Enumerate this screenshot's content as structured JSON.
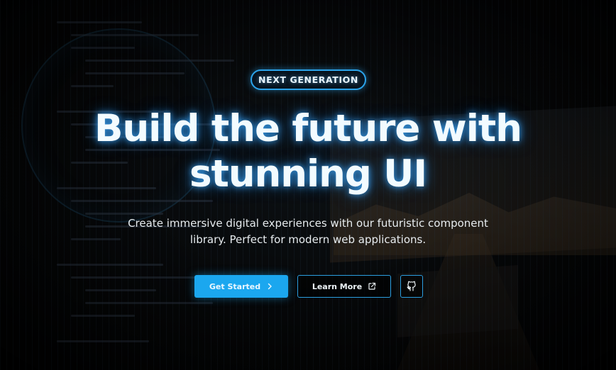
{
  "hero": {
    "badge": "NEXT GENERATION",
    "title": "Build the future with stunning UI",
    "subtitle": "Create immersive digital experiences with our futuristic component library. Perfect for modern web applications."
  },
  "actions": {
    "primary_label": "Get Started",
    "primary_icon": "chevron-right-icon",
    "secondary_label": "Learn More",
    "secondary_icon": "external-link-icon",
    "icon_button_icon": "github-icon"
  },
  "colors": {
    "accent": "#1ba7ef",
    "background": "#000000",
    "text": "#f2fbff"
  }
}
